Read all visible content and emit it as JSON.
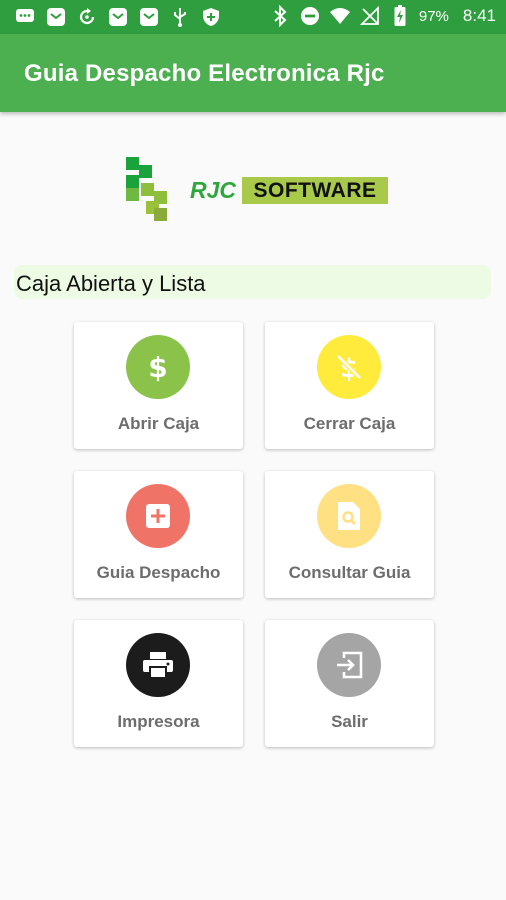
{
  "statusbar": {
    "battery_percent": "97%",
    "time": "8:41",
    "icons": [
      "message-icon",
      "mail-icon",
      "sync-icon",
      "mail-icon",
      "mail-icon",
      "usb-icon",
      "shield-icon",
      "bluetooth-icon",
      "do-not-disturb-icon",
      "wifi-icon",
      "no-signal-icon",
      "battery-icon"
    ]
  },
  "appbar": {
    "title": "Guia Despacho Electronica Rjc"
  },
  "logo": {
    "rjc": "RJC",
    "software": "SOFTWARE"
  },
  "status": {
    "text": "Caja Abierta y Lista"
  },
  "menu": {
    "abrir_caja": {
      "label": "Abrir Caja",
      "icon": "dollar-icon",
      "color": "#8bc34a"
    },
    "cerrar_caja": {
      "label": "Cerrar Caja",
      "icon": "no-money-icon",
      "color": "#ffeb3b"
    },
    "guia_despacho": {
      "label": "Guia Despacho",
      "icon": "add-box-icon",
      "color": "#ef7366"
    },
    "consultar_guia": {
      "label": "Consultar Guia",
      "icon": "find-document-icon",
      "color": "#ffe082"
    },
    "impresora": {
      "label": "Impresora",
      "icon": "printer-icon",
      "color": "#1c1c1c"
    },
    "salir": {
      "label": "Salir",
      "icon": "exit-icon",
      "color": "#a5a5a5"
    }
  }
}
